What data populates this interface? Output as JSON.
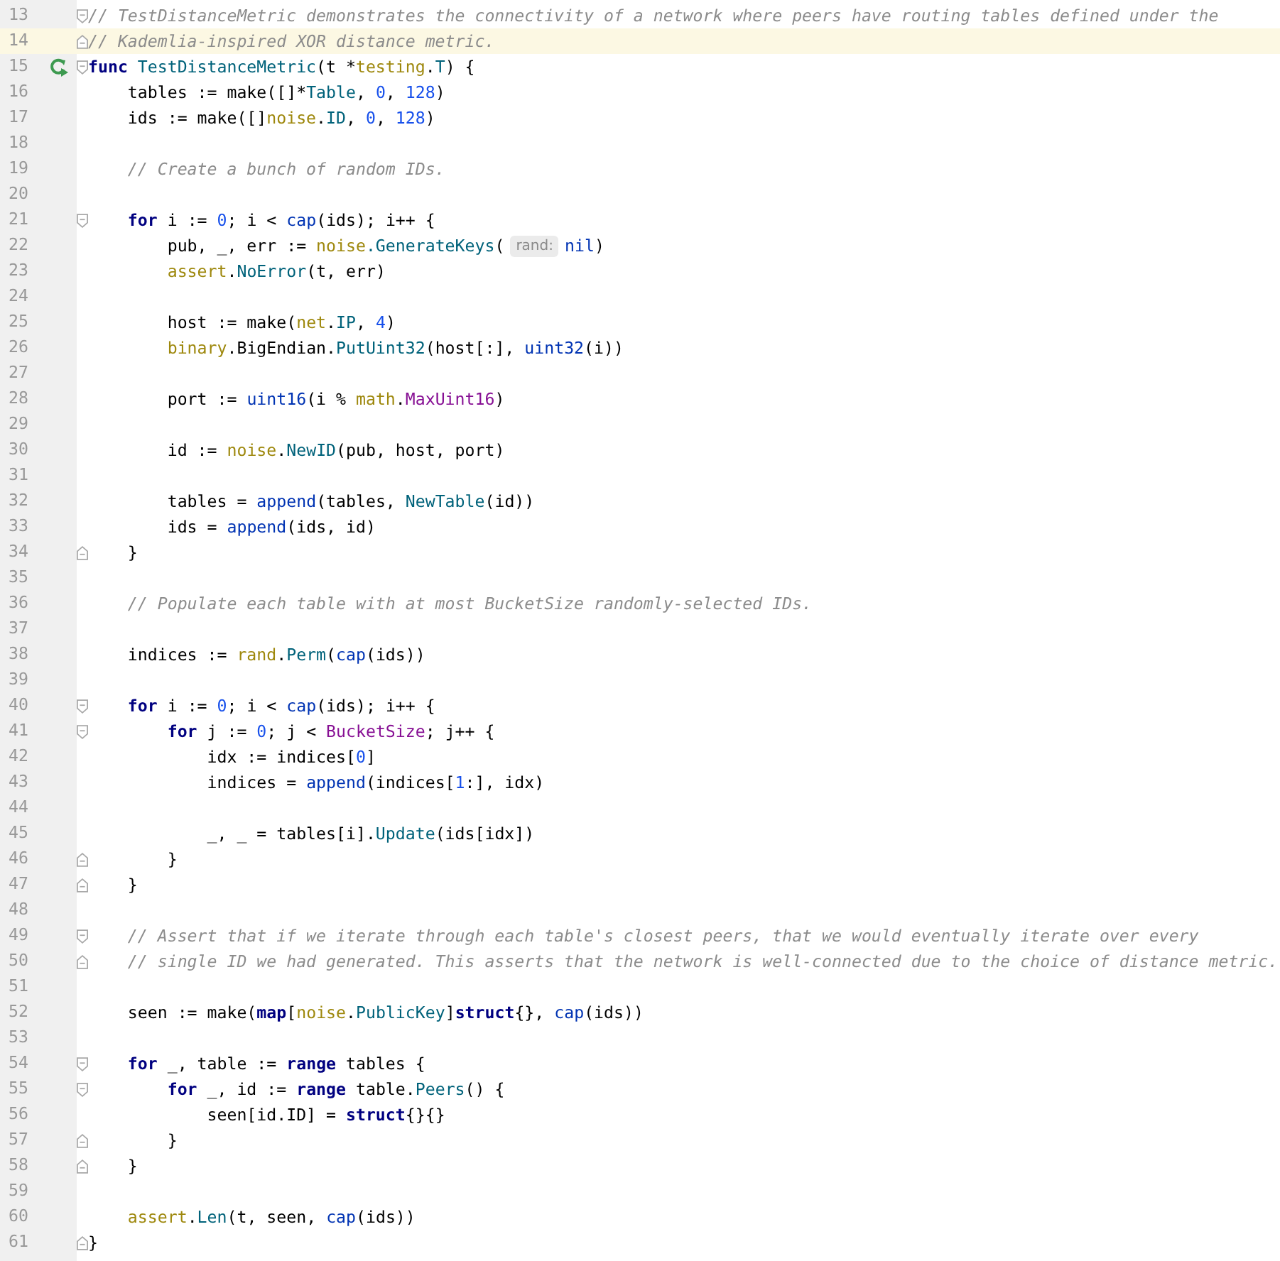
{
  "editor": {
    "lines": [
      {
        "number": "13",
        "current": false,
        "fold_start": true,
        "fold_end": false,
        "run": false,
        "tokens": [
          {
            "kind": "comment",
            "text": "// TestDistanceMetric demonstrates the connectivity of a network where peers have routing tables defined under the"
          }
        ]
      },
      {
        "number": "14",
        "current": true,
        "fold_start": false,
        "fold_end": true,
        "run": false,
        "tokens": [
          {
            "kind": "comment",
            "text": "// Kademlia-inspired XOR distance metric."
          }
        ]
      },
      {
        "number": "15",
        "current": false,
        "fold_start": true,
        "fold_end": false,
        "run": true,
        "tokens": [
          {
            "kind": "keyword",
            "text": "func"
          },
          {
            "kind": "func",
            "text": " TestDistanceMetric"
          },
          {
            "kind": "plain",
            "text": "(t *"
          },
          {
            "kind": "package",
            "text": "testing"
          },
          {
            "kind": "plain",
            "text": "."
          },
          {
            "kind": "func",
            "text": "T"
          },
          {
            "kind": "plain",
            "text": ") {"
          }
        ]
      },
      {
        "number": "16",
        "current": false,
        "fold_start": false,
        "fold_end": false,
        "run": false,
        "tokens": [
          {
            "kind": "plain",
            "text": "    tables := make([]*"
          },
          {
            "kind": "func",
            "text": "Table"
          },
          {
            "kind": "plain",
            "text": ", "
          },
          {
            "kind": "number",
            "text": "0"
          },
          {
            "kind": "plain",
            "text": ", "
          },
          {
            "kind": "number",
            "text": "128"
          },
          {
            "kind": "plain",
            "text": ")"
          }
        ]
      },
      {
        "number": "17",
        "current": false,
        "fold_start": false,
        "fold_end": false,
        "run": false,
        "tokens": [
          {
            "kind": "plain",
            "text": "    ids := make([]"
          },
          {
            "kind": "package",
            "text": "noise"
          },
          {
            "kind": "plain",
            "text": "."
          },
          {
            "kind": "func",
            "text": "ID"
          },
          {
            "kind": "plain",
            "text": ", "
          },
          {
            "kind": "number",
            "text": "0"
          },
          {
            "kind": "plain",
            "text": ", "
          },
          {
            "kind": "number",
            "text": "128"
          },
          {
            "kind": "plain",
            "text": ")"
          }
        ]
      },
      {
        "number": "18",
        "current": false,
        "fold_start": false,
        "fold_end": false,
        "run": false
      },
      {
        "number": "19",
        "current": false,
        "fold_start": false,
        "fold_end": false,
        "run": false,
        "tokens": [
          {
            "kind": "comment",
            "text": "    // Create a bunch of random IDs."
          }
        ]
      },
      {
        "number": "20",
        "current": false,
        "fold_start": false,
        "fold_end": false,
        "run": false
      },
      {
        "number": "21",
        "current": false,
        "fold_start": true,
        "fold_end": false,
        "run": false,
        "tokens": [
          {
            "kind": "keyword",
            "text": "    for"
          },
          {
            "kind": "plain",
            "text": " i := "
          },
          {
            "kind": "number",
            "text": "0"
          },
          {
            "kind": "plain",
            "text": "; i < "
          },
          {
            "kind": "builtin",
            "text": "cap"
          },
          {
            "kind": "plain",
            "text": "(ids); i++ {"
          }
        ]
      },
      {
        "number": "22",
        "current": false,
        "fold_start": false,
        "fold_end": false,
        "run": false,
        "tokens": [
          {
            "kind": "plain",
            "text": "        pub, _, err := "
          },
          {
            "kind": "package",
            "text": "noise"
          },
          {
            "kind": "func",
            "text": ".GenerateKeys"
          },
          {
            "kind": "plain",
            "text": "("
          },
          {
            "kind": "hint",
            "text": "rand:"
          },
          {
            "kind": "builtin",
            "text": "nil"
          },
          {
            "kind": "plain",
            "text": ")"
          }
        ]
      },
      {
        "number": "23",
        "current": false,
        "fold_start": false,
        "fold_end": false,
        "run": false,
        "tokens": [
          {
            "kind": "package",
            "text": "        assert"
          },
          {
            "kind": "plain",
            "text": "."
          },
          {
            "kind": "func",
            "text": "NoError"
          },
          {
            "kind": "plain",
            "text": "(t, err)"
          }
        ]
      },
      {
        "number": "24",
        "current": false,
        "fold_start": false,
        "fold_end": false,
        "run": false
      },
      {
        "number": "25",
        "current": false,
        "fold_start": false,
        "fold_end": false,
        "run": false,
        "tokens": [
          {
            "kind": "plain",
            "text": "        host := make("
          },
          {
            "kind": "package",
            "text": "net"
          },
          {
            "kind": "plain",
            "text": "."
          },
          {
            "kind": "func",
            "text": "IP"
          },
          {
            "kind": "plain",
            "text": ", "
          },
          {
            "kind": "number",
            "text": "4"
          },
          {
            "kind": "plain",
            "text": ")"
          }
        ]
      },
      {
        "number": "26",
        "current": false,
        "fold_start": false,
        "fold_end": false,
        "run": false,
        "tokens": [
          {
            "kind": "package",
            "text": "        binary"
          },
          {
            "kind": "plain",
            "text": ".BigEndian."
          },
          {
            "kind": "func",
            "text": "PutUint32"
          },
          {
            "kind": "plain",
            "text": "(host[:], "
          },
          {
            "kind": "builtin",
            "text": "uint32"
          },
          {
            "kind": "plain",
            "text": "(i))"
          }
        ]
      },
      {
        "number": "27",
        "current": false,
        "fold_start": false,
        "fold_end": false,
        "run": false
      },
      {
        "number": "28",
        "current": false,
        "fold_start": false,
        "fold_end": false,
        "run": false,
        "tokens": [
          {
            "kind": "plain",
            "text": "        port := "
          },
          {
            "kind": "builtin",
            "text": "uint16"
          },
          {
            "kind": "plain",
            "text": "(i % "
          },
          {
            "kind": "package",
            "text": "math"
          },
          {
            "kind": "plain",
            "text": "."
          },
          {
            "kind": "constant",
            "text": "MaxUint16"
          },
          {
            "kind": "plain",
            "text": ")"
          }
        ]
      },
      {
        "number": "29",
        "current": false,
        "fold_start": false,
        "fold_end": false,
        "run": false
      },
      {
        "number": "30",
        "current": false,
        "fold_start": false,
        "fold_end": false,
        "run": false,
        "tokens": [
          {
            "kind": "plain",
            "text": "        id := "
          },
          {
            "kind": "package",
            "text": "noise"
          },
          {
            "kind": "plain",
            "text": "."
          },
          {
            "kind": "func",
            "text": "NewID"
          },
          {
            "kind": "plain",
            "text": "(pub, host, port)"
          }
        ]
      },
      {
        "number": "31",
        "current": false,
        "fold_start": false,
        "fold_end": false,
        "run": false
      },
      {
        "number": "32",
        "current": false,
        "fold_start": false,
        "fold_end": false,
        "run": false,
        "tokens": [
          {
            "kind": "plain",
            "text": "        tables = "
          },
          {
            "kind": "builtin",
            "text": "append"
          },
          {
            "kind": "plain",
            "text": "(tables, "
          },
          {
            "kind": "func",
            "text": "NewTable"
          },
          {
            "kind": "plain",
            "text": "(id))"
          }
        ]
      },
      {
        "number": "33",
        "current": false,
        "fold_start": false,
        "fold_end": false,
        "run": false,
        "tokens": [
          {
            "kind": "plain",
            "text": "        ids = "
          },
          {
            "kind": "builtin",
            "text": "append"
          },
          {
            "kind": "plain",
            "text": "(ids, id)"
          }
        ]
      },
      {
        "number": "34",
        "current": false,
        "fold_start": false,
        "fold_end": true,
        "run": false,
        "tokens": [
          {
            "kind": "plain",
            "text": "    }"
          }
        ]
      },
      {
        "number": "35",
        "current": false,
        "fold_start": false,
        "fold_end": false,
        "run": false
      },
      {
        "number": "36",
        "current": false,
        "fold_start": false,
        "fold_end": false,
        "run": false,
        "tokens": [
          {
            "kind": "comment",
            "text": "    // Populate each table with at most BucketSize randomly-selected IDs."
          }
        ]
      },
      {
        "number": "37",
        "current": false,
        "fold_start": false,
        "fold_end": false,
        "run": false
      },
      {
        "number": "38",
        "current": false,
        "fold_start": false,
        "fold_end": false,
        "run": false,
        "tokens": [
          {
            "kind": "plain",
            "text": "    indices := "
          },
          {
            "kind": "package",
            "text": "rand"
          },
          {
            "kind": "plain",
            "text": "."
          },
          {
            "kind": "func",
            "text": "Perm"
          },
          {
            "kind": "plain",
            "text": "("
          },
          {
            "kind": "builtin",
            "text": "cap"
          },
          {
            "kind": "plain",
            "text": "(ids))"
          }
        ]
      },
      {
        "number": "39",
        "current": false,
        "fold_start": false,
        "fold_end": false,
        "run": false
      },
      {
        "number": "40",
        "current": false,
        "fold_start": true,
        "fold_end": false,
        "run": false,
        "tokens": [
          {
            "kind": "keyword",
            "text": "    for"
          },
          {
            "kind": "plain",
            "text": " i := "
          },
          {
            "kind": "number",
            "text": "0"
          },
          {
            "kind": "plain",
            "text": "; i < "
          },
          {
            "kind": "builtin",
            "text": "cap"
          },
          {
            "kind": "plain",
            "text": "(ids); i++ {"
          }
        ]
      },
      {
        "number": "41",
        "current": false,
        "fold_start": true,
        "fold_end": false,
        "run": false,
        "tokens": [
          {
            "kind": "keyword",
            "text": "        for"
          },
          {
            "kind": "plain",
            "text": " j := "
          },
          {
            "kind": "number",
            "text": "0"
          },
          {
            "kind": "plain",
            "text": "; j < "
          },
          {
            "kind": "constant",
            "text": "BucketSize"
          },
          {
            "kind": "plain",
            "text": "; j++ {"
          }
        ]
      },
      {
        "number": "42",
        "current": false,
        "fold_start": false,
        "fold_end": false,
        "run": false,
        "tokens": [
          {
            "kind": "plain",
            "text": "            idx := indices["
          },
          {
            "kind": "number",
            "text": "0"
          },
          {
            "kind": "plain",
            "text": "]"
          }
        ]
      },
      {
        "number": "43",
        "current": false,
        "fold_start": false,
        "fold_end": false,
        "run": false,
        "tokens": [
          {
            "kind": "plain",
            "text": "            indices = "
          },
          {
            "kind": "builtin",
            "text": "append"
          },
          {
            "kind": "plain",
            "text": "(indices["
          },
          {
            "kind": "number",
            "text": "1"
          },
          {
            "kind": "plain",
            "text": ":], idx)"
          }
        ]
      },
      {
        "number": "44",
        "current": false,
        "fold_start": false,
        "fold_end": false,
        "run": false
      },
      {
        "number": "45",
        "current": false,
        "fold_start": false,
        "fold_end": false,
        "run": false,
        "tokens": [
          {
            "kind": "plain",
            "text": "            _, _ = tables[i]."
          },
          {
            "kind": "func",
            "text": "Update"
          },
          {
            "kind": "plain",
            "text": "(ids[idx])"
          }
        ]
      },
      {
        "number": "46",
        "current": false,
        "fold_start": false,
        "fold_end": true,
        "run": false,
        "tokens": [
          {
            "kind": "plain",
            "text": "        }"
          }
        ]
      },
      {
        "number": "47",
        "current": false,
        "fold_start": false,
        "fold_end": true,
        "run": false,
        "tokens": [
          {
            "kind": "plain",
            "text": "    }"
          }
        ]
      },
      {
        "number": "48",
        "current": false,
        "fold_start": false,
        "fold_end": false,
        "run": false
      },
      {
        "number": "49",
        "current": false,
        "fold_start": true,
        "fold_end": false,
        "run": false,
        "tokens": [
          {
            "kind": "comment",
            "text": "    // Assert that if we iterate through each table's closest peers, that we would eventually iterate over every"
          }
        ]
      },
      {
        "number": "50",
        "current": false,
        "fold_start": false,
        "fold_end": true,
        "run": false,
        "tokens": [
          {
            "kind": "comment",
            "text": "    // single ID we had generated. This asserts that the network is well-connected due to the choice of distance metric."
          }
        ]
      },
      {
        "number": "51",
        "current": false,
        "fold_start": false,
        "fold_end": false,
        "run": false
      },
      {
        "number": "52",
        "current": false,
        "fold_start": false,
        "fold_end": false,
        "run": false,
        "tokens": [
          {
            "kind": "plain",
            "text": "    seen := make("
          },
          {
            "kind": "keyword",
            "text": "map"
          },
          {
            "kind": "plain",
            "text": "["
          },
          {
            "kind": "package",
            "text": "noise"
          },
          {
            "kind": "plain",
            "text": "."
          },
          {
            "kind": "func",
            "text": "PublicKey"
          },
          {
            "kind": "plain",
            "text": "]"
          },
          {
            "kind": "keyword",
            "text": "struct"
          },
          {
            "kind": "plain",
            "text": "{}, "
          },
          {
            "kind": "builtin",
            "text": "cap"
          },
          {
            "kind": "plain",
            "text": "(ids))"
          }
        ]
      },
      {
        "number": "53",
        "current": false,
        "fold_start": false,
        "fold_end": false,
        "run": false
      },
      {
        "number": "54",
        "current": false,
        "fold_start": true,
        "fold_end": false,
        "run": false,
        "tokens": [
          {
            "kind": "keyword",
            "text": "    for"
          },
          {
            "kind": "plain",
            "text": " _, table := "
          },
          {
            "kind": "keyword",
            "text": "range"
          },
          {
            "kind": "plain",
            "text": " tables {"
          }
        ]
      },
      {
        "number": "55",
        "current": false,
        "fold_start": true,
        "fold_end": false,
        "run": false,
        "tokens": [
          {
            "kind": "keyword",
            "text": "        for"
          },
          {
            "kind": "plain",
            "text": " _, id := "
          },
          {
            "kind": "keyword",
            "text": "range"
          },
          {
            "kind": "plain",
            "text": " table."
          },
          {
            "kind": "func",
            "text": "Peers"
          },
          {
            "kind": "plain",
            "text": "() {"
          }
        ]
      },
      {
        "number": "56",
        "current": false,
        "fold_start": false,
        "fold_end": false,
        "run": false,
        "tokens": [
          {
            "kind": "plain",
            "text": "            seen[id.ID] = "
          },
          {
            "kind": "keyword",
            "text": "struct"
          },
          {
            "kind": "plain",
            "text": "{}{}"
          }
        ]
      },
      {
        "number": "57",
        "current": false,
        "fold_start": false,
        "fold_end": true,
        "run": false,
        "tokens": [
          {
            "kind": "plain",
            "text": "        }"
          }
        ]
      },
      {
        "number": "58",
        "current": false,
        "fold_start": false,
        "fold_end": true,
        "run": false,
        "tokens": [
          {
            "kind": "plain",
            "text": "    }"
          }
        ]
      },
      {
        "number": "59",
        "current": false,
        "fold_start": false,
        "fold_end": false,
        "run": false
      },
      {
        "number": "60",
        "current": false,
        "fold_start": false,
        "fold_end": false,
        "run": false,
        "tokens": [
          {
            "kind": "package",
            "text": "    assert"
          },
          {
            "kind": "plain",
            "text": "."
          },
          {
            "kind": "func",
            "text": "Len"
          },
          {
            "kind": "plain",
            "text": "(t, seen, "
          },
          {
            "kind": "builtin",
            "text": "cap"
          },
          {
            "kind": "plain",
            "text": "(ids))"
          }
        ]
      },
      {
        "number": "61",
        "current": false,
        "fold_start": false,
        "fold_end": true,
        "run": false,
        "tokens": [
          {
            "kind": "plain",
            "text": "}"
          }
        ]
      }
    ]
  }
}
